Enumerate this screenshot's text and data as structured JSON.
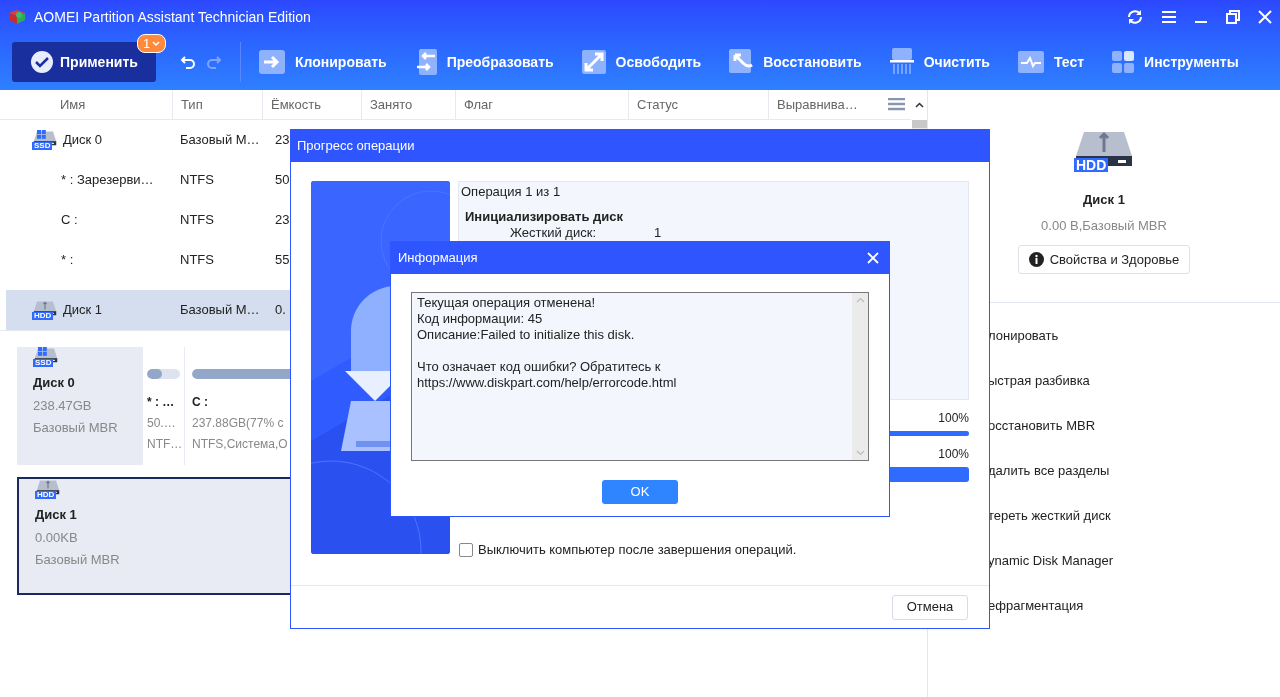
{
  "window": {
    "title": "AOMEI Partition Assistant Technician Edition"
  },
  "toolbar": {
    "apply": {
      "label": "Применить",
      "badge": "1"
    },
    "tools": [
      {
        "label": "Клонировать"
      },
      {
        "label": "Преобразовать"
      },
      {
        "label": "Освободить"
      },
      {
        "label": "Восстановить"
      },
      {
        "label": "Очистить"
      },
      {
        "label": "Тест"
      },
      {
        "label": "Инструменты"
      }
    ]
  },
  "table": {
    "columns": [
      "Имя",
      "Тип",
      "Ёмкость",
      "Занято",
      "Флаг",
      "Статус",
      "Выравнива…"
    ],
    "rows": [
      {
        "kind": "disk",
        "badge": "SSD",
        "name": "Диск 0",
        "type": "Базовый М…",
        "capacity": "23",
        "selected": false
      },
      {
        "kind": "partition",
        "name": "* : Зарезерви…",
        "type": "NTFS",
        "capacity": "50",
        "selected": false
      },
      {
        "kind": "partition",
        "name": "C :",
        "type": "NTFS",
        "capacity": "23",
        "selected": false
      },
      {
        "kind": "partition",
        "name": "* :",
        "type": "NTFS",
        "capacity": "55",
        "selected": false
      },
      {
        "kind": "disk",
        "badge": "HDD",
        "name": "Диск 1",
        "type": "Базовый М…",
        "capacity": "0.",
        "selected": true
      }
    ]
  },
  "disk_map": [
    {
      "badge": "SSD",
      "name": "Диск 0",
      "size": "238.47GB",
      "style": "Базовый MBR",
      "selected": false,
      "partitions": [
        {
          "name": "* : …",
          "size": "50.…",
          "fs": "NTF…",
          "level": 0.45
        },
        {
          "name": "C :",
          "size": "237.88GB(77% с",
          "fs": "NTFS,Система,О",
          "level": 0.77
        }
      ]
    },
    {
      "badge": "HDD",
      "name": "Диск 1",
      "size": "0.00KB",
      "style": "Базовый MBR",
      "selected": true
    }
  ],
  "details": {
    "badge": "HDD",
    "name": "Диск 1",
    "info": "0.00 B,Базовый MBR",
    "button": "Свойства и Здоровье",
    "actions": [
      "лонировать",
      "ыстрая разбивка",
      "осстановить MBR",
      "далить все разделы",
      "тереть жесткий диск",
      "ynamic Disk Manager",
      "ефрагментация"
    ]
  },
  "progress_dialog": {
    "title": "Прогресс операции",
    "operation": "Операция 1 из 1",
    "heading": "Инициализировать диск",
    "field": {
      "label": "Жесткий диск:",
      "value": "1"
    },
    "progress": [
      {
        "percent": "100%",
        "level": 1
      },
      {
        "percent": "100%",
        "level": 1
      }
    ],
    "shutdown": {
      "label": "Выключить компьютер после завершения операций.",
      "checked": false
    },
    "cancel": "Отмена"
  },
  "info_dialog": {
    "title": "Информация",
    "paragraphs": [
      "Текущая операция отменена!\nКод информации: 45\nОписание:Failed to initialize this disk.",
      "Что означает код ошибки? Обратитесь к\nhttps://www.diskpart.com/help/errorcode.html"
    ],
    "ok": "OK"
  }
}
